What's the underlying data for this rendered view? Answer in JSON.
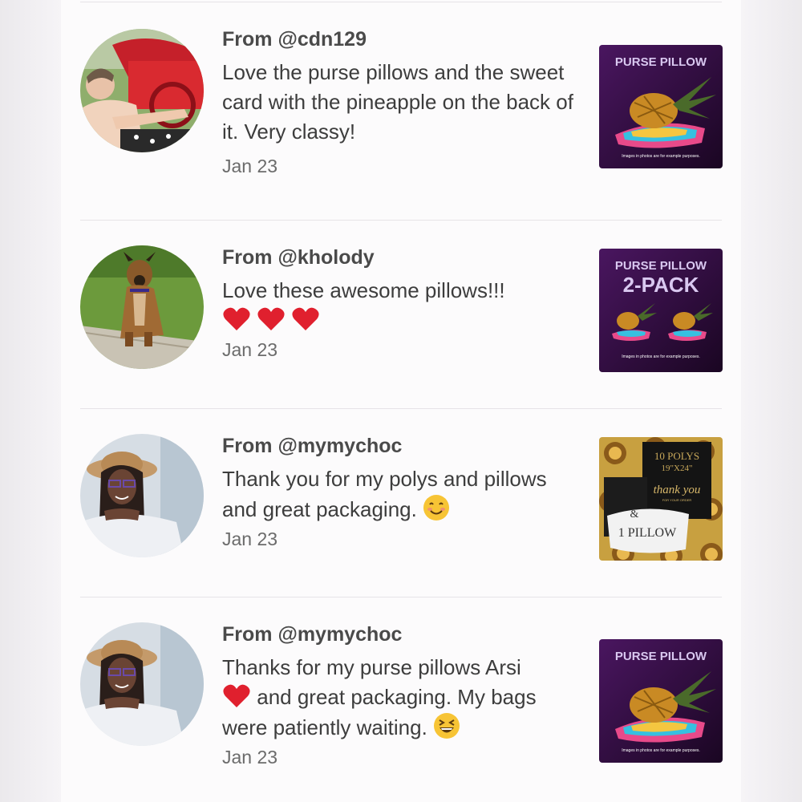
{
  "reviews": [
    {
      "from": "From @cdn129",
      "text": "Love the purse pillows and the sweet card with the pineapple on the back of it. Very classy!",
      "date": "Jan 23",
      "avatar": "person-driving-red-car-avatar",
      "product": {
        "title": "PURSE PILLOW",
        "subtitle": "",
        "footer": "Images in photos are for example purposes."
      }
    },
    {
      "from": "From @kholody",
      "text": "Love these awesome pillows!!!",
      "hearts": 3,
      "date": "Jan 23",
      "avatar": "dog-on-grass-avatar",
      "product": {
        "title": "PURSE PILLOW",
        "subtitle": "2-PACK",
        "footer": "Images in photos are for example purposes."
      }
    },
    {
      "from": "From @mymychoc",
      "text": "Thank you for my polys and pillows and great packaging.",
      "emoji": "smiling-face-emoji",
      "date": "Jan 23",
      "avatar": "woman-in-hat-avatar",
      "product": {
        "line1": "10 POLYS",
        "line2": "19\"X24\"",
        "line3": "thank you",
        "line4": "FOR YOUR ORDER",
        "line5": "&",
        "line6": "1 PILLOW"
      }
    },
    {
      "from": "From @mymychoc",
      "text_part1": "Thanks for my purse pillows Arsi",
      "text_part2": "and great packaging. My bags were patiently waiting.",
      "emoji": "grinning-squinting-face-emoji",
      "date": "Jan 23",
      "avatar": "woman-in-hat-avatar",
      "product": {
        "title": "PURSE PILLOW",
        "subtitle": "",
        "footer": "Images in photos are for example purposes."
      }
    }
  ],
  "colors": {
    "heart": "#e0202e",
    "product_bg": "#3a0f4a",
    "product_title": "#d9c8f0"
  }
}
